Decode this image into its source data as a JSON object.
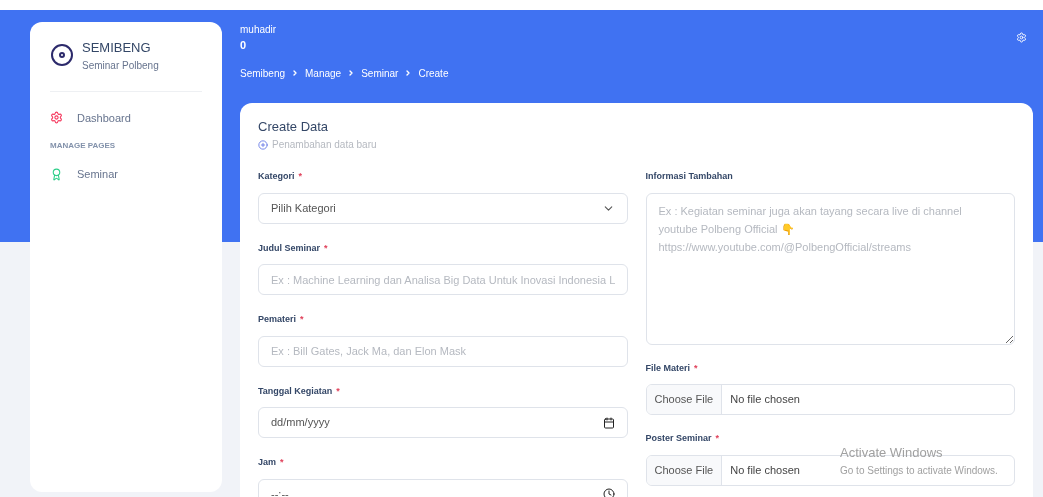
{
  "sidebar": {
    "brand": {
      "title": "SEMIBENG",
      "subtitle": "Seminar Polbeng"
    },
    "items": [
      {
        "kind": "link",
        "label": "Dashboard",
        "selected": false
      },
      {
        "kind": "heading",
        "label": "MANAGE PAGES"
      },
      {
        "kind": "link",
        "label": "Seminar",
        "selected": false
      }
    ]
  },
  "header": {
    "user": "muhadir",
    "count": "0",
    "breadcrumb": [
      "Semibeng",
      "Manage",
      "Seminar",
      "Create"
    ]
  },
  "card": {
    "title": "Create Data",
    "subtitle": "Penambahan data baru",
    "left_fields": [
      {
        "kind": "select",
        "label": "Kategori",
        "required_mark": "*",
        "value": "Pilih Kategori"
      },
      {
        "kind": "text",
        "label": "Judul Seminar",
        "required_mark": "*",
        "placeholder": "Ex : Machine Learning dan Analisa Big Data Untuk Inovasi Indonesia L"
      },
      {
        "kind": "text",
        "label": "Pemateri",
        "required_mark": "*",
        "placeholder": "Ex : Bill Gates, Jack Ma, dan Elon Mask"
      },
      {
        "kind": "date",
        "label": "Tanggal Kegiatan",
        "required_mark": "*",
        "value": "dd/mm/yyyy"
      },
      {
        "kind": "time",
        "label": "Jam",
        "required_mark": "*",
        "value": "--:--"
      }
    ],
    "right_fields": [
      {
        "kind": "textarea",
        "label": "Informasi Tambahan",
        "placeholder": "Ex : Kegiatan seminar juga akan tayang secara live di channel\nyoutube Polbeng Official 👇\nhttps://www.youtube.com/@PolbengOfficial/streams"
      },
      {
        "kind": "file",
        "label": "File Materi",
        "required_mark": "*",
        "button": "Choose File",
        "value": "No file chosen"
      },
      {
        "kind": "file",
        "label": "Poster Seminar",
        "required_mark": "*",
        "button": "Choose File",
        "value": "No file chosen"
      }
    ]
  },
  "os_overlay": {
    "title": "Activate Windows",
    "text": "Go to Settings to activate Windows."
  }
}
